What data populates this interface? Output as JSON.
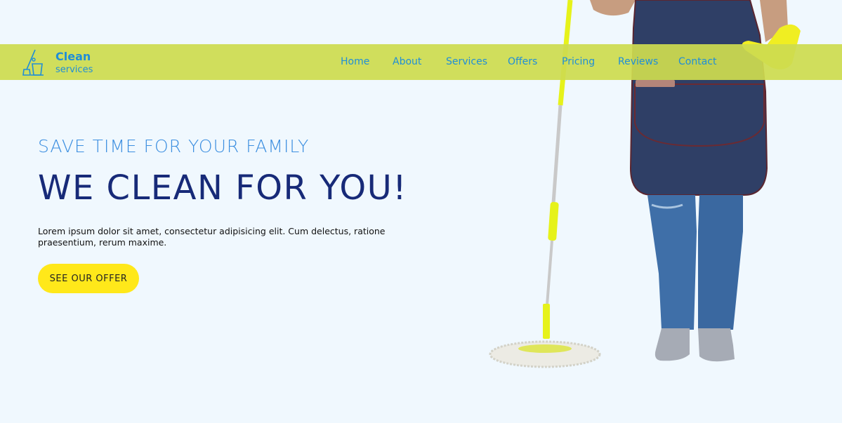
{
  "brand": {
    "line1": "Clean",
    "line2": "services"
  },
  "nav": {
    "items": [
      {
        "label": "Home"
      },
      {
        "label": "About"
      },
      {
        "label": "Services"
      },
      {
        "label": "Offers"
      },
      {
        "label": "Pricing"
      },
      {
        "label": "Reviews"
      },
      {
        "label": "Contact"
      }
    ]
  },
  "hero": {
    "subtitle": "SAVE TIME FOR YOUR FAMILY",
    "title": "WE CLEAN FOR YOU!",
    "description": "Lorem ipsum dolor sit amet, consectetur adipisicing elit. Cum delectus, ratione praesentium, rerum maxime.",
    "cta_label": "SEE OUR OFFER"
  },
  "colors": {
    "background": "#f0f8fe",
    "navbar": "#cddc50",
    "nav_text": "#1f8ed8",
    "subtitle": "#3b8ee0",
    "title": "#172a78",
    "cta": "#ffe81a"
  },
  "icons": {
    "logo": "mop-bucket-icon"
  }
}
